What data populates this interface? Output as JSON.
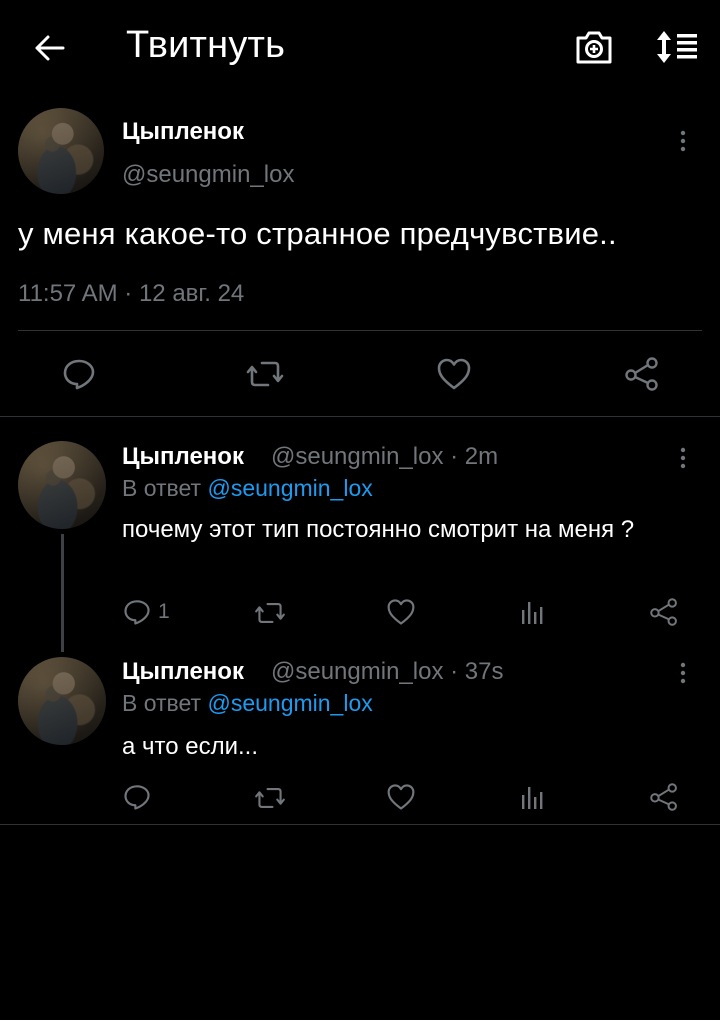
{
  "header": {
    "title": "Твитнуть"
  },
  "main_tweet": {
    "name": "Цыпленок",
    "handle": "@seungmin_lox",
    "text": "у меня какое-то странное предчувствие..",
    "meta": "11:57 AM · 12 авг. 24"
  },
  "replies": [
    {
      "name": "Цыпленок",
      "handle_time": "@seungmin_lox · 2m",
      "replying_prefix": "В ответ ",
      "replying_to": "@seungmin_lox",
      "text": "почему этот тип постоянно смотрит на меня ?",
      "reply_count": "1"
    },
    {
      "name": "Цыпленок",
      "handle_time": "@seungmin_lox · 37s",
      "replying_prefix": "В ответ ",
      "replying_to": "@seungmin_lox",
      "text": "а что если...",
      "reply_count": ""
    }
  ],
  "icons": {
    "back": "arrow-left-icon",
    "camera": "camera-icon",
    "sort": "sort-icon",
    "more": "more-vertical-icon",
    "reply": "reply-icon",
    "retweet": "retweet-icon",
    "like": "heart-icon",
    "views": "analytics-icon",
    "share": "share-icon"
  },
  "colors": {
    "background": "#000000",
    "text": "#ffffff",
    "muted": "#71767b",
    "link": "#1d9bf0",
    "divider": "#2f3336"
  }
}
